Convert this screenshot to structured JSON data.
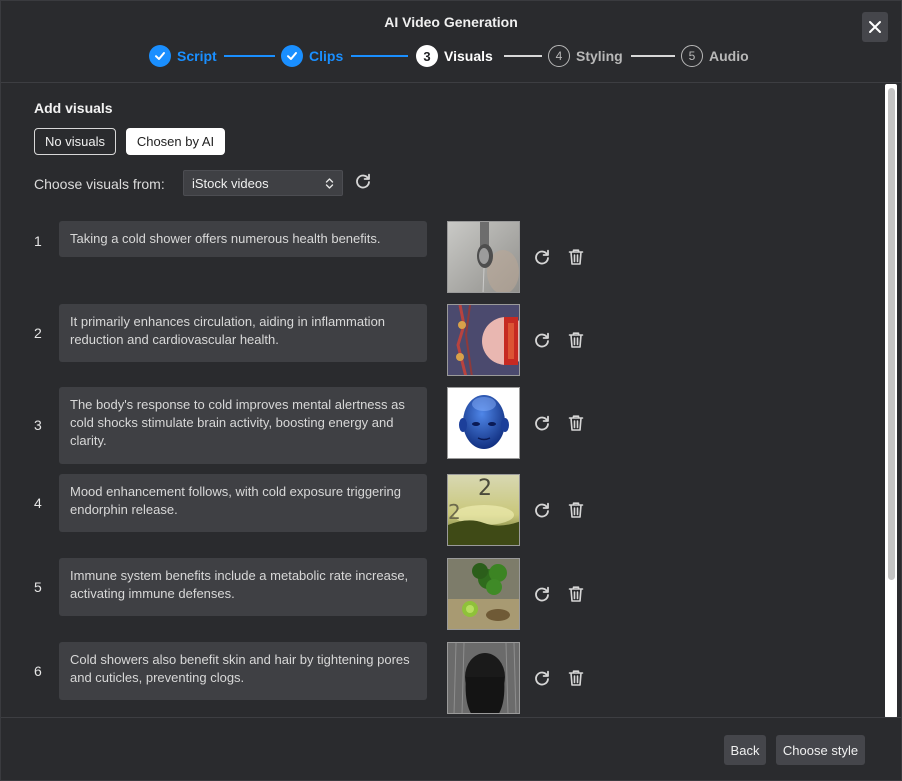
{
  "dialog": {
    "title": "AI Video Generation",
    "close_label": "Close"
  },
  "stepper": {
    "steps": [
      {
        "number": "1",
        "label": "Script",
        "state": "done"
      },
      {
        "number": "2",
        "label": "Clips",
        "state": "done"
      },
      {
        "number": "3",
        "label": "Visuals",
        "state": "active"
      },
      {
        "number": "4",
        "label": "Styling",
        "state": "future"
      },
      {
        "number": "5",
        "label": "Audio",
        "state": "future"
      }
    ]
  },
  "visuals": {
    "section_title": "Add visuals",
    "toggle_none": "No visuals",
    "toggle_ai": "Chosen by AI",
    "source_label": "Choose visuals from:",
    "source_value": "iStock videos"
  },
  "clips": [
    {
      "number": "1",
      "text": "Taking a cold shower offers numerous health benefits.",
      "thumb": "shower-head-thumbnail"
    },
    {
      "number": "2",
      "text": "It primarily enhances circulation, aiding in inflammation reduction and cardiovascular health.",
      "thumb": "circulation-anatomy-thumbnail"
    },
    {
      "number": "3",
      "text": "The body's response to cold improves mental alertness as cold shocks stimulate brain activity, boosting energy and clarity.",
      "thumb": "blue-head-thumbnail"
    },
    {
      "number": "4",
      "text": "Mood enhancement follows, with cold exposure triggering endorphin release.",
      "thumb": "sunrise-numbers-thumbnail"
    },
    {
      "number": "5",
      "text": "Immune system benefits include a metabolic rate increase, activating immune defenses.",
      "thumb": "vegetables-thumbnail"
    },
    {
      "number": "6",
      "text": "Cold showers also benefit skin and hair by tightening pores and cuticles, preventing clogs.",
      "thumb": "hair-shower-thumbnail"
    }
  ],
  "footer": {
    "back_label": "Back",
    "next_label": "Choose style"
  },
  "colors": {
    "accent": "#1a8fff",
    "background": "#2a2b2e",
    "card": "#3f4044"
  }
}
